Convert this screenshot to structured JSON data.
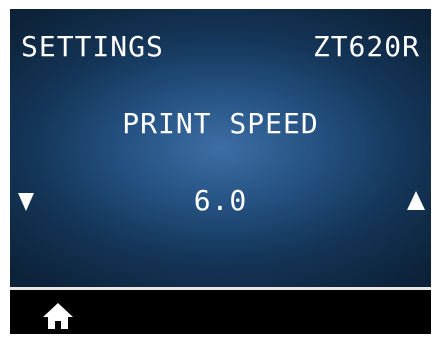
{
  "header": {
    "menu_label": "SETTINGS",
    "model": "ZT620R"
  },
  "setting": {
    "name": "PRINT SPEED",
    "value": "6.0"
  },
  "controls": {
    "decrease_icon": "triangle-down-icon",
    "increase_icon": "triangle-up-icon",
    "home_icon": "home-icon"
  },
  "colors": {
    "screen_center": "#3d6ea6",
    "screen_edge": "#0c2238",
    "bezel": "#000000",
    "text": "#ffffff"
  }
}
